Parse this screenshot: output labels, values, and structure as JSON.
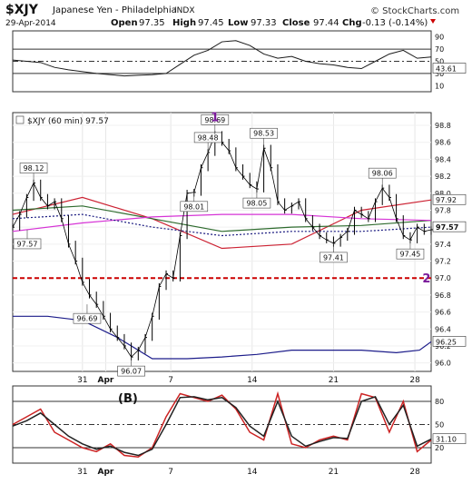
{
  "header": {
    "symbol": "$XJY",
    "name": "Japanese Yen - Philadelphia",
    "exchange": "INDX",
    "date": "29-Apr-2014",
    "open_label": "Open",
    "open": "97.35",
    "high_label": "High",
    "high": "97.45",
    "low_label": "Low",
    "low": "97.33",
    "close_label": "Close",
    "close": "97.44",
    "chg_label": "Chg",
    "chg": "-0.13 (-0.14%)",
    "watermark": "© StockCharts.com"
  },
  "colors": {
    "price": "#000000",
    "ma_red": "#cc2233",
    "ma_green": "#2e6b2e",
    "ma_magenta": "#d633d6",
    "dotted_blue": "#1a1a80",
    "band_navy": "#1c1c8a",
    "support_red": "#cc0000",
    "wave_label": "#7a1a9a",
    "rsi_line": "#1a1a1a",
    "osc_red": "#cc2222",
    "osc_black": "#222222",
    "rsi_pos_fill": "#2f7f5f",
    "rsi_neg_fill": "#c08040"
  },
  "chart_data": [
    {
      "type": "line",
      "name": "rsi-panel",
      "y_ticks": [
        10,
        30,
        50,
        70,
        90
      ],
      "ylim": [
        0,
        100
      ],
      "reference_lines": [
        30,
        50,
        70
      ],
      "x": [
        0,
        6,
        12,
        18,
        24,
        30,
        36,
        42,
        48,
        54,
        60,
        66,
        72,
        78,
        84,
        90,
        96,
        102,
        108,
        114,
        120,
        126,
        132,
        138,
        144,
        150,
        156,
        162,
        168,
        174,
        180
      ],
      "values": [
        52,
        50,
        48,
        40,
        36,
        33,
        30,
        28,
        26,
        27,
        28,
        30,
        45,
        60,
        68,
        82,
        84,
        76,
        62,
        55,
        58,
        50,
        46,
        44,
        40,
        38,
        50,
        62,
        68,
        55,
        57
      ],
      "last_label": "43.61"
    },
    {
      "type": "line",
      "name": "price-panel",
      "title": "$XJY (60 min) 97.57",
      "ylim": [
        95.9,
        98.95
      ],
      "y_ticks": [
        "96.0",
        "96.2",
        "96.4",
        "96.6",
        "96.8",
        "97.0",
        "97.2",
        "97.4",
        "97.6",
        "97.8",
        "98.0",
        "98.2",
        "98.4",
        "98.6",
        "98.8"
      ],
      "x_ticks": [
        {
          "x": 30,
          "label": "31"
        },
        {
          "x": 40,
          "label": "Apr"
        },
        {
          "x": 68,
          "label": "7"
        },
        {
          "x": 103,
          "label": "14"
        },
        {
          "x": 138,
          "label": "21"
        },
        {
          "x": 173,
          "label": "28"
        }
      ],
      "x_range": [
        0,
        180
      ],
      "price": {
        "x": [
          0,
          3,
          6,
          9,
          12,
          15,
          18,
          21,
          24,
          27,
          30,
          33,
          36,
          39,
          42,
          45,
          48,
          51,
          54,
          57,
          60,
          63,
          66,
          69,
          72,
          75,
          78,
          81,
          84,
          87,
          90,
          93,
          96,
          99,
          102,
          105,
          108,
          111,
          114,
          117,
          120,
          123,
          126,
          129,
          132,
          135,
          138,
          141,
          144,
          147,
          150,
          153,
          156,
          159,
          162,
          165,
          168,
          171,
          174,
          177,
          180
        ],
        "values": [
          97.6,
          97.75,
          97.95,
          98.12,
          97.95,
          97.85,
          97.9,
          97.7,
          97.4,
          97.2,
          96.95,
          96.8,
          96.69,
          96.55,
          96.4,
          96.3,
          96.2,
          96.07,
          96.15,
          96.3,
          96.55,
          96.9,
          97.05,
          97.0,
          97.5,
          98.0,
          98.01,
          98.3,
          98.48,
          98.69,
          98.6,
          98.5,
          98.3,
          98.2,
          98.1,
          98.05,
          98.53,
          98.3,
          97.9,
          97.8,
          97.85,
          97.9,
          97.7,
          97.6,
          97.5,
          97.45,
          97.41,
          97.48,
          97.55,
          97.8,
          97.75,
          97.7,
          97.9,
          98.06,
          97.95,
          97.7,
          97.5,
          97.45,
          97.6,
          97.55,
          97.57
        ]
      },
      "series": [
        {
          "name": "ma-red",
          "x": [
            0,
            30,
            60,
            90,
            120,
            150,
            180
          ],
          "values": [
            97.75,
            97.95,
            97.7,
            97.35,
            97.4,
            97.8,
            97.92
          ]
        },
        {
          "name": "ma-green",
          "x": [
            0,
            30,
            60,
            90,
            120,
            150,
            180
          ],
          "values": [
            97.8,
            97.85,
            97.7,
            97.55,
            97.6,
            97.62,
            97.68
          ]
        },
        {
          "name": "ma-magenta",
          "x": [
            0,
            30,
            60,
            90,
            120,
            150,
            180
          ],
          "values": [
            97.55,
            97.65,
            97.72,
            97.75,
            97.75,
            97.7,
            97.68
          ]
        },
        {
          "name": "dotted-blue",
          "x": [
            0,
            30,
            60,
            90,
            120,
            150,
            180
          ],
          "values": [
            97.7,
            97.75,
            97.6,
            97.5,
            97.55,
            97.55,
            97.6
          ]
        },
        {
          "name": "lower-band",
          "x": [
            0,
            15,
            30,
            45,
            60,
            75,
            90,
            105,
            120,
            135,
            150,
            165,
            175,
            180
          ],
          "values": [
            96.55,
            96.55,
            96.5,
            96.3,
            96.05,
            96.05,
            96.07,
            96.1,
            96.15,
            96.15,
            96.15,
            96.12,
            96.15,
            96.25
          ]
        }
      ],
      "support_level": 97.0,
      "callouts": [
        {
          "x": 9,
          "value": 98.12,
          "label": "98.12",
          "side": "top"
        },
        {
          "x": 0,
          "value": 97.57,
          "label": "97.57",
          "side": "bottom"
        },
        {
          "x": 32,
          "value": 96.69,
          "label": "96.69",
          "side": "bottom"
        },
        {
          "x": 51,
          "value": 96.07,
          "label": "96.07",
          "side": "bottom"
        },
        {
          "x": 84,
          "value": 98.48,
          "label": "98.48",
          "side": "top"
        },
        {
          "x": 78,
          "value": 98.01,
          "label": "98.01",
          "side": "bottom"
        },
        {
          "x": 87,
          "value": 98.69,
          "label": "98.69",
          "side": "top"
        },
        {
          "x": 105,
          "value": 98.05,
          "label": "98.05",
          "side": "bottom"
        },
        {
          "x": 108,
          "value": 98.53,
          "label": "98.53",
          "side": "top"
        },
        {
          "x": 138,
          "value": 97.41,
          "label": "97.41",
          "side": "bottom"
        },
        {
          "x": 159,
          "value": 98.06,
          "label": "98.06",
          "side": "top"
        },
        {
          "x": 171,
          "value": 97.45,
          "label": "97.45",
          "side": "bottom"
        }
      ],
      "right_labels": [
        {
          "value": 97.92,
          "label": "97.92"
        },
        {
          "value": 97.6,
          "label": "97.57"
        },
        {
          "value": 96.25,
          "label": "96.25"
        }
      ],
      "wave_labels": [
        {
          "x": 87,
          "value": 98.85,
          "label": "1"
        },
        {
          "x": 178,
          "value": 97.0,
          "label": "2"
        }
      ]
    },
    {
      "type": "line",
      "name": "stochastic-panel",
      "label": "(B)",
      "ylim": [
        0,
        100
      ],
      "y_ticks": [
        20,
        50,
        80
      ],
      "reference_lines": [
        20,
        50,
        80
      ],
      "series": [
        {
          "name": "fast",
          "x": [
            0,
            6,
            12,
            18,
            24,
            30,
            36,
            42,
            48,
            54,
            60,
            66,
            72,
            78,
            84,
            90,
            96,
            102,
            108,
            114,
            120,
            126,
            132,
            138,
            144,
            150,
            156,
            162,
            168,
            174,
            180
          ],
          "values": [
            50,
            60,
            70,
            40,
            30,
            20,
            15,
            25,
            10,
            8,
            20,
            60,
            90,
            85,
            80,
            88,
            70,
            40,
            30,
            90,
            25,
            20,
            30,
            35,
            30,
            90,
            85,
            40,
            80,
            15,
            30
          ]
        },
        {
          "name": "slow",
          "x": [
            0,
            6,
            12,
            18,
            24,
            30,
            36,
            42,
            48,
            54,
            60,
            66,
            72,
            78,
            84,
            90,
            96,
            102,
            108,
            114,
            120,
            126,
            132,
            138,
            144,
            150,
            156,
            162,
            168,
            174,
            180
          ],
          "values": [
            48,
            55,
            65,
            50,
            35,
            25,
            18,
            22,
            14,
            10,
            18,
            50,
            85,
            86,
            82,
            85,
            72,
            48,
            35,
            80,
            35,
            22,
            28,
            33,
            32,
            80,
            86,
            50,
            75,
            22,
            31
          ]
        }
      ],
      "last_label": "31.10",
      "x_ticks": [
        {
          "x": 30,
          "label": "31"
        },
        {
          "x": 40,
          "label": "Apr"
        },
        {
          "x": 68,
          "label": "7"
        },
        {
          "x": 103,
          "label": "14"
        },
        {
          "x": 138,
          "label": "21"
        },
        {
          "x": 173,
          "label": "28"
        }
      ]
    }
  ]
}
